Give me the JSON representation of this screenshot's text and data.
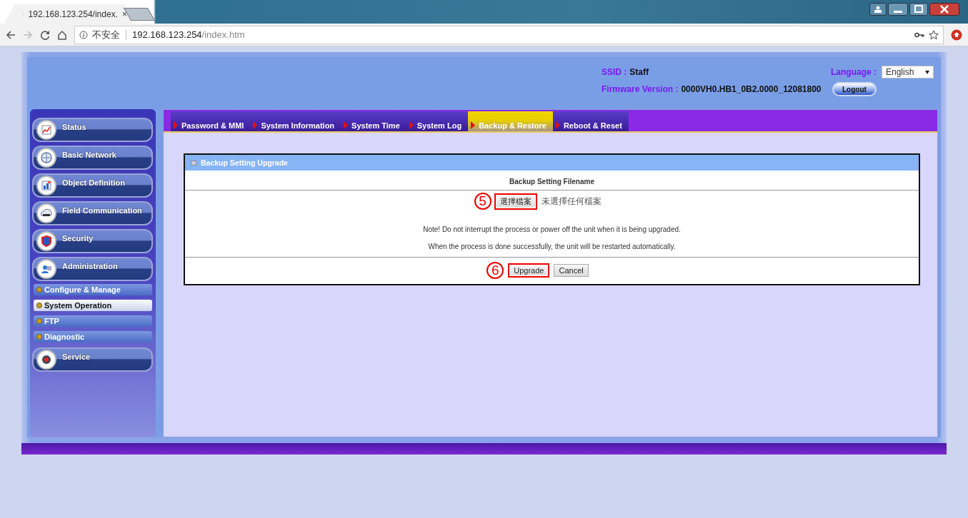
{
  "browser": {
    "tab_title": "192.168.123.254/index.",
    "tab_close": "×",
    "security": "不安全",
    "url_host": "192.168.123.254",
    "url_path": "/index.htm"
  },
  "header": {
    "ssid_label": "SSID :",
    "ssid": "Staff",
    "firmware_label": "Firmware Version :",
    "firmware": "0000VH0.HB1_0B2.0000_12081800",
    "language_label": "Language :",
    "language": "English",
    "logout": "Logout"
  },
  "sidebar": {
    "items": [
      {
        "label": "Status"
      },
      {
        "label": "Basic Network"
      },
      {
        "label": "Object Definition"
      },
      {
        "label": "Field Communication"
      },
      {
        "label": "Security"
      },
      {
        "label": "Administration",
        "children": [
          {
            "label": "Configure & Manage",
            "selected": false
          },
          {
            "label": "System Operation",
            "selected": true
          },
          {
            "label": "FTP",
            "selected": false
          },
          {
            "label": "Diagnostic",
            "selected": false
          }
        ]
      },
      {
        "label": "Service"
      }
    ]
  },
  "tabs": [
    {
      "label": "Password & MMI",
      "selected": false
    },
    {
      "label": "System Information",
      "selected": false
    },
    {
      "label": "System Time",
      "selected": false
    },
    {
      "label": "System Log",
      "selected": false
    },
    {
      "label": "Backup & Restore",
      "selected": true
    },
    {
      "label": "Reboot & Reset",
      "selected": false
    }
  ],
  "panel": {
    "title": "Backup Setting Upgrade",
    "column_header": "Backup Setting Filename",
    "file_picker": {
      "button": "選擇檔案",
      "status": "未選擇任何檔案",
      "callout": "5",
      "highlighted": true
    },
    "notes": [
      "Note! Do not interrupt the process or power off the unit when it is being upgraded.",
      "When the process is done successfully, the unit will be restarted automatically."
    ],
    "actions": {
      "callout": "6",
      "buttons": [
        {
          "label": "Upgrade",
          "highlighted": true
        },
        {
          "label": "Cancel",
          "highlighted": false
        }
      ]
    }
  }
}
